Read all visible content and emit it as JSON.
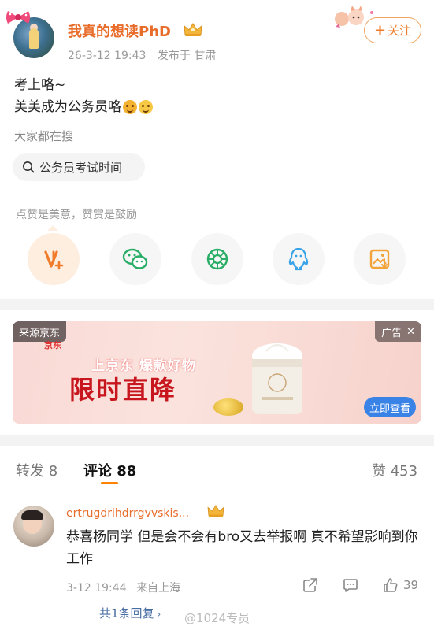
{
  "post": {
    "username": "我真的想读PhD",
    "date": "26-3-12 19:43",
    "location": "发布于 甘肃",
    "follow_label": "关注",
    "line1": "考上咯~",
    "line2": "美美成为公务员咯",
    "line2_emojis": [
      "shy-face-emoji",
      "wink-face-emoji"
    ]
  },
  "search": {
    "title": "大家都在搜",
    "chip": "公务员考试时间"
  },
  "reward": {
    "tip": "点赞是美意，赞赏是鼓励"
  },
  "share": [
    {
      "name": "reward-v-icon",
      "color": "#f07b2a"
    },
    {
      "name": "wechat-icon",
      "color": "#2aae67"
    },
    {
      "name": "moments-icon",
      "color": "#2aae67"
    },
    {
      "name": "qq-icon",
      "color": "#3aa3e8"
    },
    {
      "name": "save-image-icon",
      "color": "#f2a33a"
    }
  ],
  "ad": {
    "source": "来源京东",
    "tag": "广告",
    "jd_small": "京东",
    "line1": "上京东 爆款好物",
    "line2": "限时直降",
    "cta": "立即查看"
  },
  "tabs": {
    "repost": "转发 8",
    "comment": "评论 88",
    "likes": "赞 453"
  },
  "comment": {
    "name": "ertrugdrihdrrgvvskis...",
    "text": "恭喜杨同学 但是会不会有bro又去举报啊 真不希望影响到你工作",
    "date": "3-12 19:44",
    "location": "来自上海",
    "likes": "39",
    "reply_link": "共1条回复",
    "watermark": "@1024专员"
  },
  "colors": {
    "accent_orange": "#ff8200",
    "username_orange": "#e86c2a",
    "link_blue": "#4a6fa5",
    "ad_red": "#c7161e",
    "cta_blue": "#3a83e6"
  }
}
